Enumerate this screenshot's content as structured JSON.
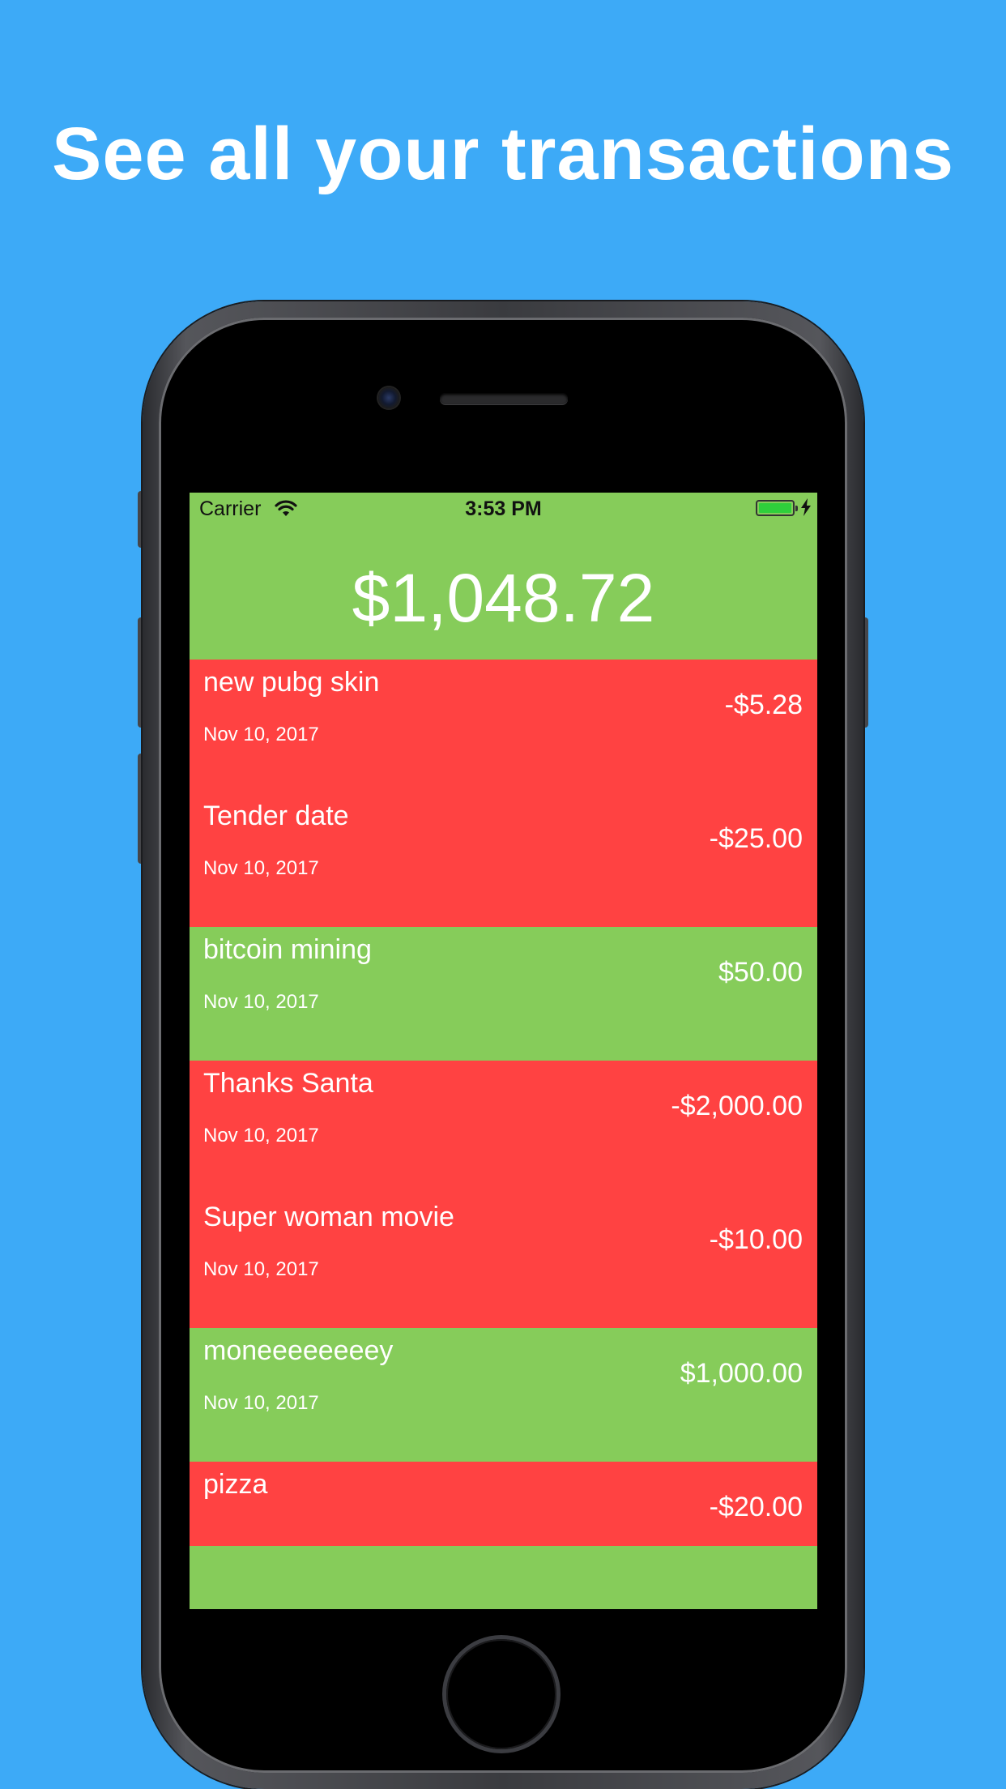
{
  "headline": "See all your transactions",
  "status_bar": {
    "carrier": "Carrier",
    "time": "3:53 PM"
  },
  "balance": "$1,048.72",
  "transactions": [
    {
      "title": "new pubg skin",
      "date": "Nov 10, 2017",
      "amount": "-$5.28",
      "type": "negative"
    },
    {
      "title": "Tender date",
      "date": "Nov 10, 2017",
      "amount": "-$25.00",
      "type": "negative"
    },
    {
      "title": "bitcoin mining",
      "date": "Nov 10, 2017",
      "amount": "$50.00",
      "type": "positive"
    },
    {
      "title": "Thanks Santa",
      "date": "Nov 10, 2017",
      "amount": "-$2,000.00",
      "type": "negative"
    },
    {
      "title": "Super woman movie",
      "date": "Nov 10, 2017",
      "amount": "-$10.00",
      "type": "negative"
    },
    {
      "title": "moneeeeeeeey",
      "date": "Nov 10, 2017",
      "amount": "$1,000.00",
      "type": "positive"
    },
    {
      "title": "pizza",
      "date": "",
      "amount": "-$20.00",
      "type": "negative"
    }
  ],
  "colors": {
    "background": "#3DAAF7",
    "positive": "#86CC5A",
    "negative": "#FF4242",
    "battery": "#2FCF3B"
  },
  "icons": {
    "wifi": "wifi-icon",
    "battery": "battery-icon",
    "charging": "bolt-icon"
  }
}
